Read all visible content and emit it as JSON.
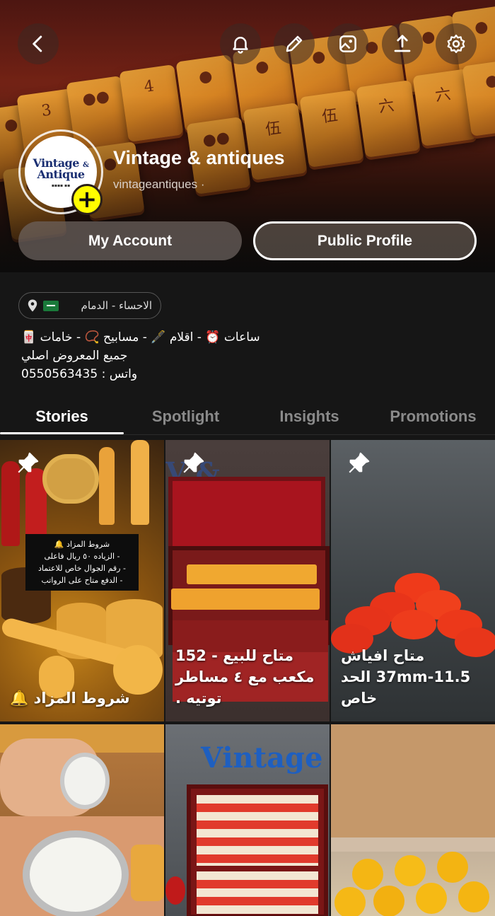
{
  "header": {
    "profile_name": "Vintage & antiques",
    "handle": "vintageantiques ·",
    "avatar": {
      "line1": "Vintage",
      "amp": "&",
      "line2": "Antique"
    },
    "add_badge": "+",
    "buttons": {
      "my_account": "My Account",
      "public_profile": "Public Profile"
    },
    "icons": [
      "back-icon",
      "bell-icon",
      "pencil-icon",
      "image-icon",
      "share-icon",
      "gear-icon"
    ]
  },
  "bio": {
    "location": "الاحساء - الدمام",
    "line1": "ساعات ⏰ - اقلام 🖋️ - مسابيح 📿 - خامات 🀄",
    "line2": "جميع المعروض اصلي",
    "line3": "واتس : 0550563435"
  },
  "tabs": [
    {
      "label": "Stories",
      "active": true
    },
    {
      "label": "Spotlight",
      "active": false
    },
    {
      "label": "Insights",
      "active": false
    },
    {
      "label": "Promotions",
      "active": false
    }
  ],
  "grid": {
    "items": [
      {
        "caption": "شروط المزاد 🔔",
        "pinned": true,
        "note": {
          "title": "شروط المزاد 🔔",
          "l1": "- الزياده ٥٠ ريال فاعلى",
          "l2": "- رقم الجوال خاص للاعتماد",
          "l3": "- الدفع متاح على الرواتب"
        }
      },
      {
        "caption": "متاح للبيع - 152 مكعب مع ٤ مساطر توتيه .",
        "pinned": true
      },
      {
        "caption": "متاح افياش 37mm-11.5 الحد خاص",
        "pinned": true
      },
      {
        "caption": "",
        "pinned": false
      },
      {
        "caption": "",
        "pinned": false
      },
      {
        "caption": "",
        "pinned": false
      }
    ]
  },
  "colors": {
    "background": "#161616",
    "add_badge": "#fffc00",
    "tab_active": "#ffffff",
    "tab_inactive": "#8a8a8a"
  }
}
